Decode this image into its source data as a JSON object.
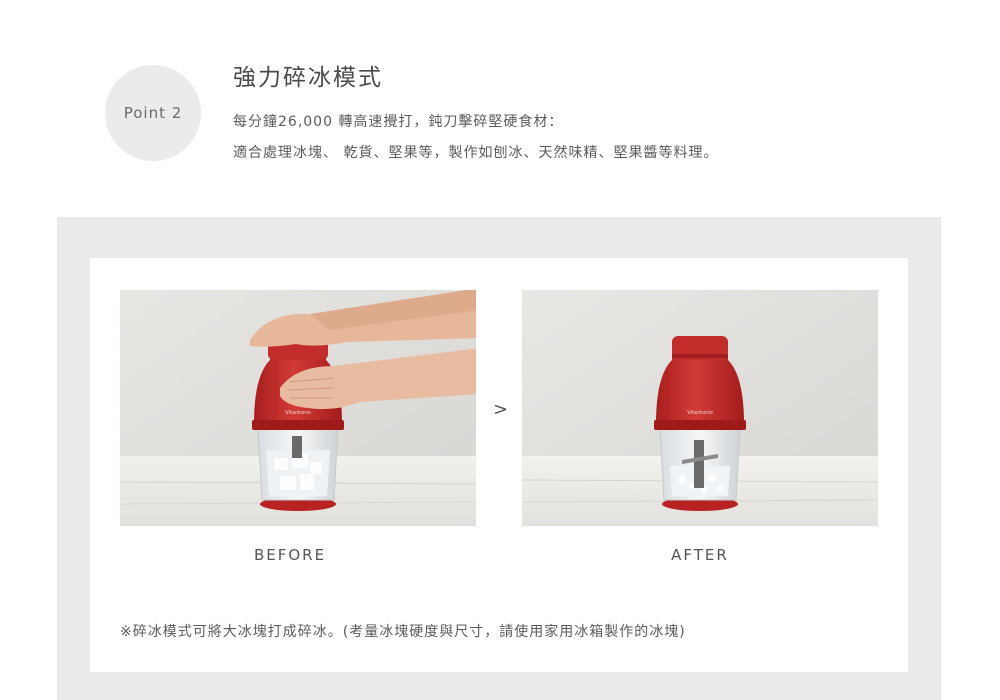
{
  "header": {
    "point_label": "Point 2",
    "title": "強力碎冰模式",
    "desc_line1": "每分鐘26,000 轉高速攪打，鈍刀擊碎堅硬食材：",
    "desc_line2": "適合處理冰塊、 乾貨、堅果等，製作如刨冰、天然味精、堅果醬等料理。"
  },
  "comparison": {
    "before_label": "BEFORE",
    "after_label": "AFTER",
    "arrow": ">",
    "product_brand": "Vitantonio"
  },
  "footnote": "※碎冰模式可將大冰塊打成碎冰。(考量冰塊硬度與尺寸，請使用家用冰箱製作的冰塊)",
  "colors": {
    "panel_bg": "#ebebeb",
    "product_red": "#c42a2a",
    "text": "#555555"
  }
}
